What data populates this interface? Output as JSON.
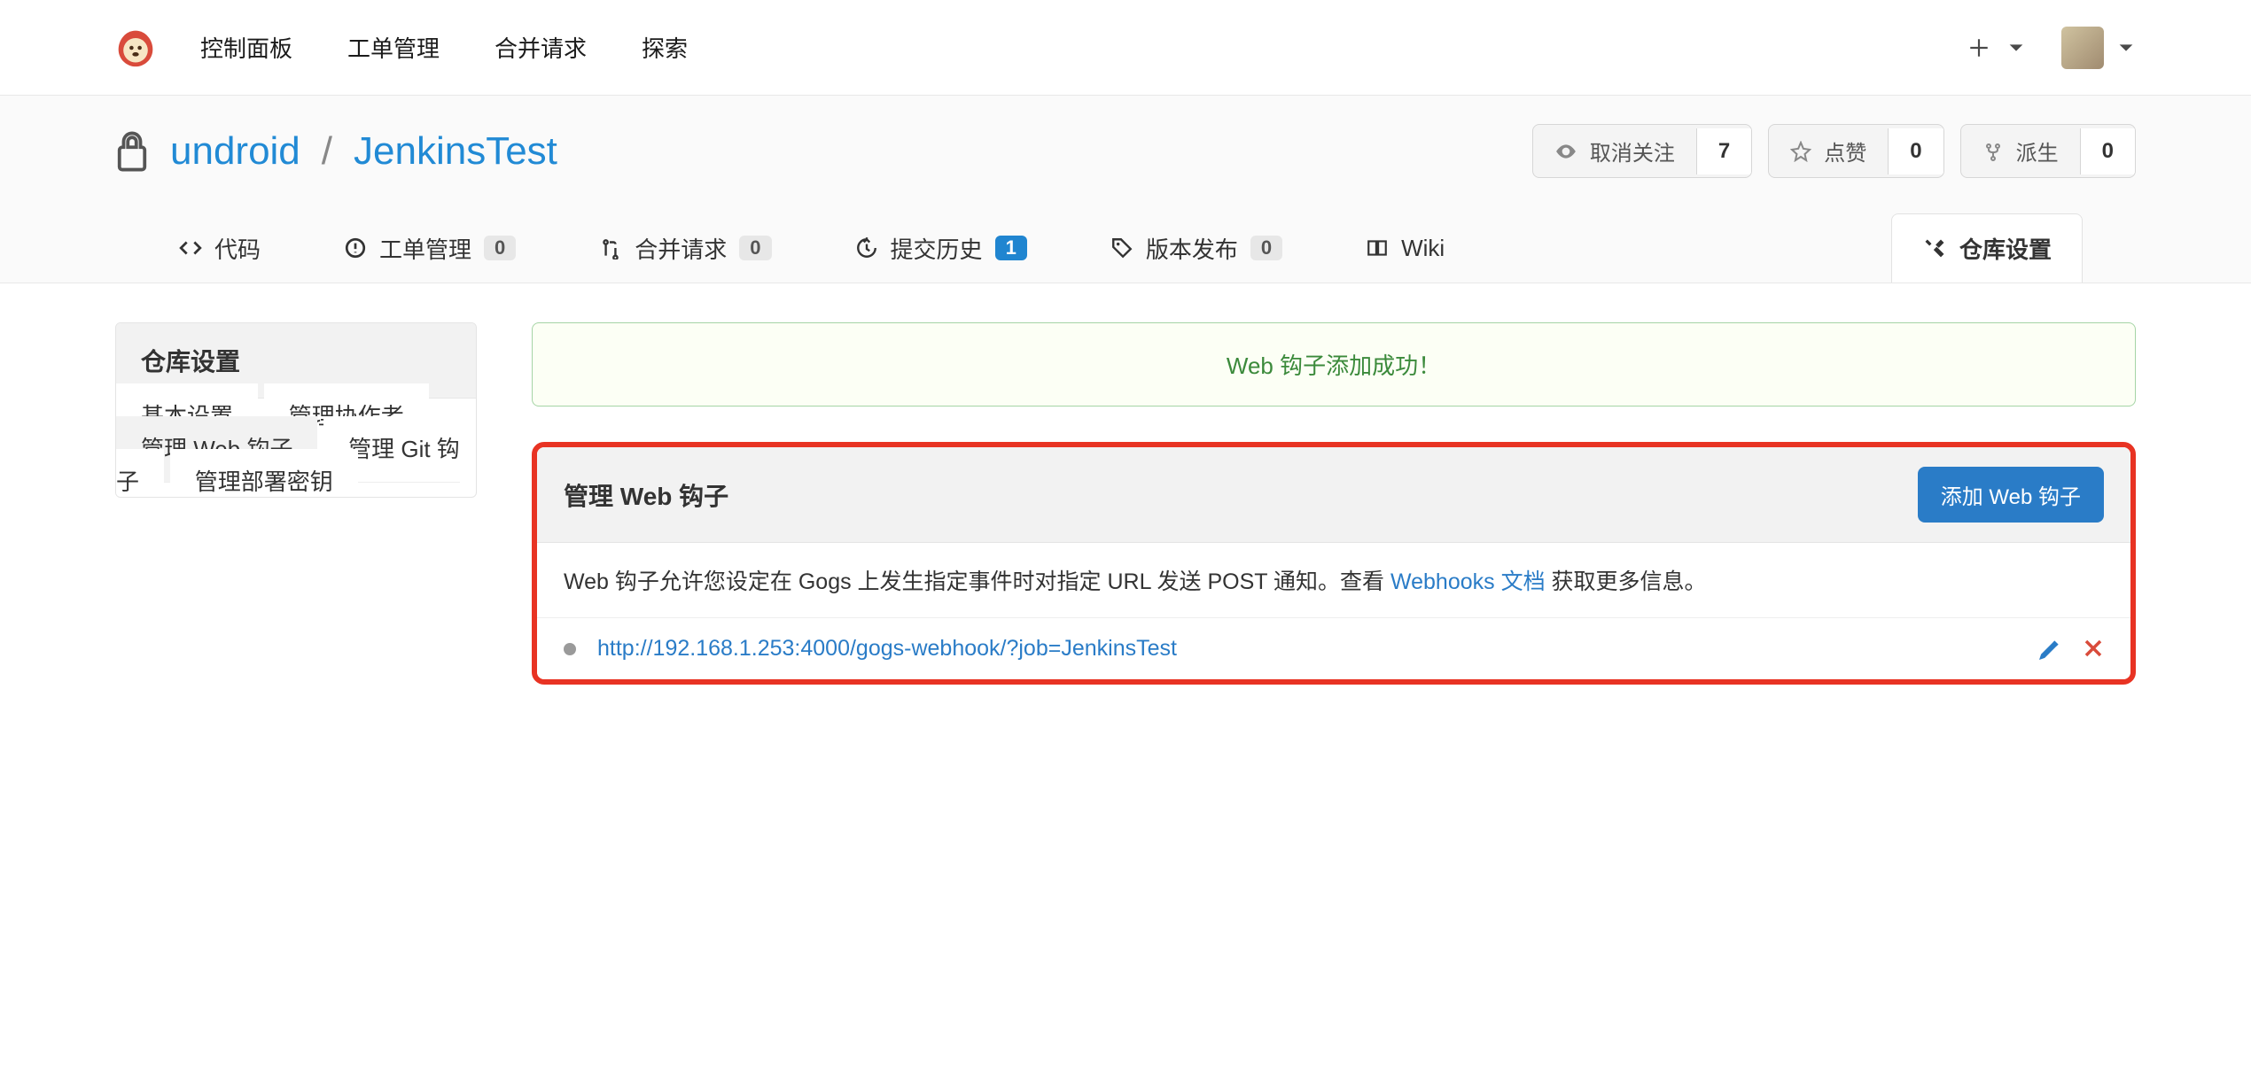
{
  "nav": {
    "items": [
      "控制面板",
      "工单管理",
      "合并请求",
      "探索"
    ]
  },
  "repo": {
    "owner": "undroid",
    "name": "JenkinsTest",
    "actions": {
      "watch": {
        "label": "取消关注",
        "count": "7"
      },
      "star": {
        "label": "点赞",
        "count": "0"
      },
      "fork": {
        "label": "派生",
        "count": "0"
      }
    }
  },
  "tabs": {
    "code": {
      "label": "代码"
    },
    "issues": {
      "label": "工单管理",
      "count": "0"
    },
    "pulls": {
      "label": "合并请求",
      "count": "0"
    },
    "commits": {
      "label": "提交历史",
      "count": "1"
    },
    "releases": {
      "label": "版本发布",
      "count": "0"
    },
    "wiki": {
      "label": "Wiki"
    },
    "settings": {
      "label": "仓库设置"
    }
  },
  "sidebar": {
    "title": "仓库设置",
    "items": [
      "基本设置",
      "管理协作者",
      "管理 Web 钩子",
      "管理 Git 钩子",
      "管理部署密钥"
    ],
    "activeIndex": 2
  },
  "alert": {
    "message": "Web 钩子添加成功！"
  },
  "hooks": {
    "title": "管理 Web 钩子",
    "add_label": "添加 Web 钩子",
    "desc_prefix": "Web 钩子允许您设定在 Gogs 上发生指定事件时对指定 URL 发送 POST 通知。查看 ",
    "desc_link": "Webhooks 文档",
    "desc_suffix": " 获取更多信息。",
    "list": [
      {
        "url": "http://192.168.1.253:4000/gogs-webhook/?job=JenkinsTest"
      }
    ]
  }
}
